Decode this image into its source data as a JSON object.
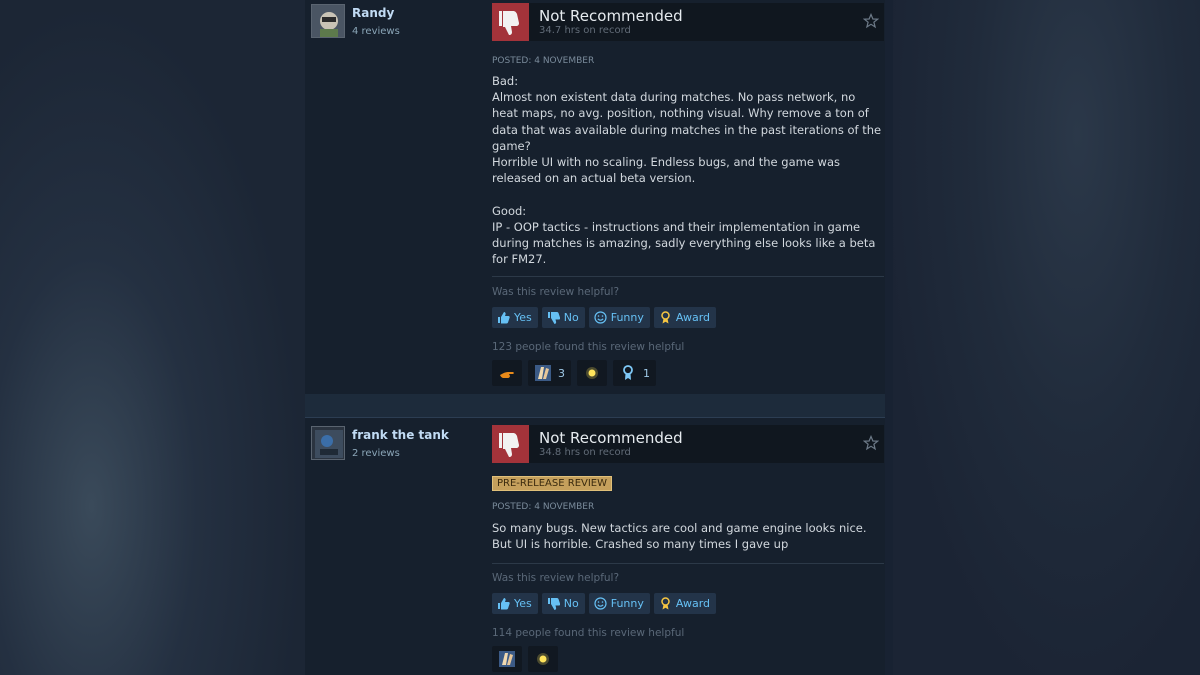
{
  "reviews": [
    {
      "author": "Randy",
      "review_count": "4 reviews",
      "verdict": "Not Recommended",
      "hours": "34.7 hrs on record",
      "pre_release": "",
      "posted": "POSTED: 4 NOVEMBER",
      "body": [
        "Bad:",
        "Almost non existent data during matches. No pass network, no heat maps, no avg. position, nothing visual. Why remove a ton of data that was available during matches in the past iterations of the game?",
        "Horrible UI with no scaling. Endless bugs, and the game was released on an actual beta version.",
        "",
        "Good:",
        "IP - OOP tactics - instructions and their implementation in game during matches is amazing, sadly everything else looks like a beta for FM27."
      ],
      "helpful_question": "Was this review helpful?",
      "buttons": {
        "yes": "Yes",
        "no": "No",
        "funny": "Funny",
        "award": "Award"
      },
      "found_helpful": "123 people found this review helpful",
      "awards": [
        {
          "icon": "hand-pointing-award-icon",
          "count": ""
        },
        {
          "icon": "clapping-award-icon",
          "count": "3"
        },
        {
          "icon": "sparkle-award-icon",
          "count": ""
        },
        {
          "icon": "ribbon-medal-award-icon",
          "count": "1"
        }
      ]
    },
    {
      "author": "frank the tank",
      "review_count": "2 reviews",
      "verdict": "Not Recommended",
      "hours": "34.8 hrs on record",
      "pre_release": "PRE-RELEASE REVIEW",
      "posted": "POSTED: 4 NOVEMBER",
      "body": [
        "So many bugs. New tactics are cool and game engine looks nice. But UI is horrible. Crashed so many times I gave up"
      ],
      "helpful_question": "Was this review helpful?",
      "buttons": {
        "yes": "Yes",
        "no": "No",
        "funny": "Funny",
        "award": "Award"
      },
      "found_helpful": "114 people found this review helpful",
      "awards": [
        {
          "icon": "clapping-award-icon",
          "count": ""
        },
        {
          "icon": "sparkle-award-icon",
          "count": ""
        }
      ]
    }
  ],
  "colors": {
    "thumb_down_bg": "#a3333a",
    "link_blue": "#66c0f4",
    "pre_release_bg": "#c5a05c"
  }
}
